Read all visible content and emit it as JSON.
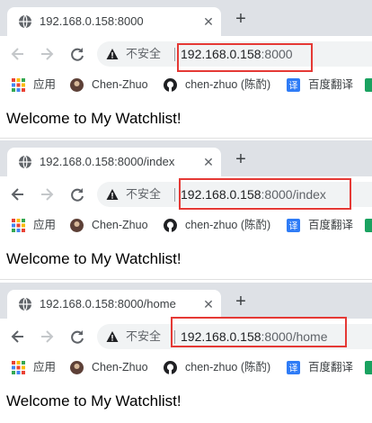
{
  "colors": {
    "tabbar": "#dee1e6",
    "highlight": "#e53935",
    "omnibox": "#f1f3f4"
  },
  "strings": {
    "insecure": "不安全",
    "bm_apps": "应用",
    "bm_chen": "Chen-Zhuo",
    "bm_github": "chen-zhuo (陈酌)",
    "bm_fanyi": "百度翻译",
    "page_text": "Welcome to My Watchlist!"
  },
  "windows": [
    {
      "tab_title": "192.168.0.158:8000",
      "url_host": "192.168.0.158",
      "url_rest": ":8000"
    },
    {
      "tab_title": "192.168.0.158:8000/index",
      "url_host": "192.168.0.158",
      "url_rest": ":8000/index"
    },
    {
      "tab_title": "192.168.0.158:8000/home",
      "url_host": "192.168.0.158",
      "url_rest": ":8000/home"
    }
  ]
}
